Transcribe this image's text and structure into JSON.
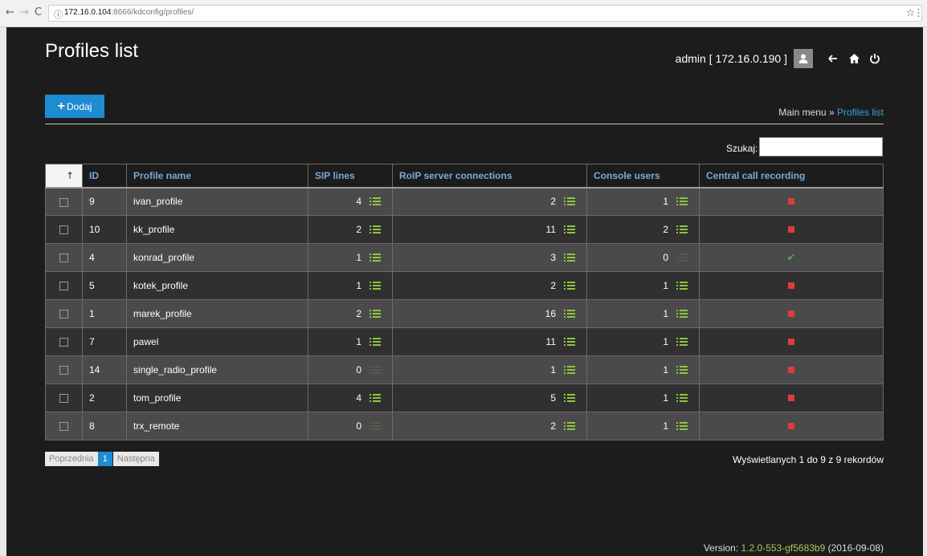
{
  "browser": {
    "url_host": "172.16.0.104",
    "url_path": ":8666/kdconfig/profiles/",
    "back_icon": "←",
    "forward_icon": "→",
    "reload_icon": "C",
    "info_icon": "ⓘ",
    "star_icon": "☆",
    "menu_icon": "⋮"
  },
  "header": {
    "title": "Profiles list",
    "user": "admin [ 172.16.0.190 ]",
    "back_icon": "←"
  },
  "toolbar": {
    "add_label": "Dodaj"
  },
  "breadcrumb": {
    "root": "Main menu",
    "sep": " » ",
    "current": "Profiles list"
  },
  "search": {
    "label": "Szukaj:",
    "value": ""
  },
  "table": {
    "sort_arrow": "↑",
    "columns": [
      "ID",
      "Profile name",
      "SIP lines",
      "RoIP server connections",
      "Console users",
      "Central call recording"
    ],
    "rows": [
      {
        "id": "9",
        "name": "ivan_profile",
        "sip": "4",
        "roip": "2",
        "console": "1",
        "recording": false
      },
      {
        "id": "10",
        "name": "kk_profile",
        "sip": "2",
        "roip": "11",
        "console": "2",
        "recording": false
      },
      {
        "id": "4",
        "name": "konrad_profile",
        "sip": "1",
        "roip": "3",
        "console": "0",
        "recording": true
      },
      {
        "id": "5",
        "name": "kotek_profile",
        "sip": "1",
        "roip": "2",
        "console": "1",
        "recording": false
      },
      {
        "id": "1",
        "name": "marek_profile",
        "sip": "2",
        "roip": "16",
        "console": "1",
        "recording": false
      },
      {
        "id": "7",
        "name": "pawel",
        "sip": "1",
        "roip": "11",
        "console": "1",
        "recording": false
      },
      {
        "id": "14",
        "name": "single_radio_profile",
        "sip": "0",
        "roip": "1",
        "console": "1",
        "recording": false
      },
      {
        "id": "2",
        "name": "tom_profile",
        "sip": "4",
        "roip": "5",
        "console": "1",
        "recording": false
      },
      {
        "id": "8",
        "name": "trx_remote",
        "sip": "0",
        "roip": "2",
        "console": "1",
        "recording": false
      }
    ]
  },
  "pagination": {
    "prev": "Poprzednia",
    "current": "1",
    "next": "Następna"
  },
  "info": "Wyświetlanych 1 do 9 z 9 rekordów",
  "footer": {
    "version_label": "Version: ",
    "version": "1.2.0-553-gf5683b9",
    "date": " (2016-09-08)"
  },
  "colors": {
    "accent": "#1e8bd2",
    "list_icon": "#8dc63f",
    "recording_off": "#e03b3b",
    "recording_on": "#4cae4c"
  }
}
